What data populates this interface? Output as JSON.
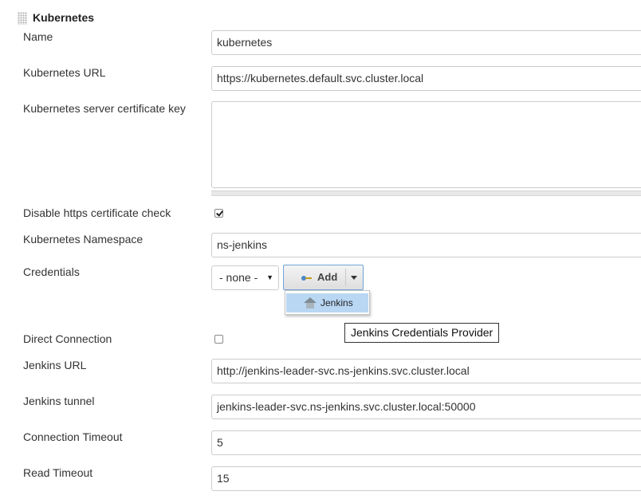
{
  "section": {
    "title": "Kubernetes"
  },
  "name": {
    "label": "Name",
    "value": "kubernetes"
  },
  "kubernetes_url": {
    "label": "Kubernetes URL",
    "value": "https://kubernetes.default.svc.cluster.local"
  },
  "server_cert_key": {
    "label": "Kubernetes server certificate key",
    "value": ""
  },
  "disable_https_check": {
    "label": "Disable https certificate check",
    "checked": true
  },
  "namespace": {
    "label": "Kubernetes Namespace",
    "value": "ns-jenkins"
  },
  "credentials": {
    "label": "Credentials",
    "selected": "- none -",
    "add_label": "Add",
    "menu_item": "Jenkins",
    "tooltip": "Jenkins Credentials Provider"
  },
  "direct_connection": {
    "label": "Direct Connection",
    "checked": false
  },
  "jenkins_url": {
    "label": "Jenkins URL",
    "value": "http://jenkins-leader-svc.ns-jenkins.svc.cluster.local"
  },
  "jenkins_tunnel": {
    "label": "Jenkins tunnel",
    "value": "jenkins-leader-svc.ns-jenkins.svc.cluster.local:50000"
  },
  "connection_timeout": {
    "label": "Connection Timeout",
    "value": "5"
  },
  "read_timeout": {
    "label": "Read Timeout",
    "value": "15"
  },
  "icons": [
    "drag-handle-icon",
    "key-icon",
    "chevron-down-icon",
    "jenkins-house-icon"
  ],
  "colors": {
    "focus_border": "#6fa3d8",
    "menu_highlight": "#b9d7f3",
    "field_border": "#cccccc"
  }
}
